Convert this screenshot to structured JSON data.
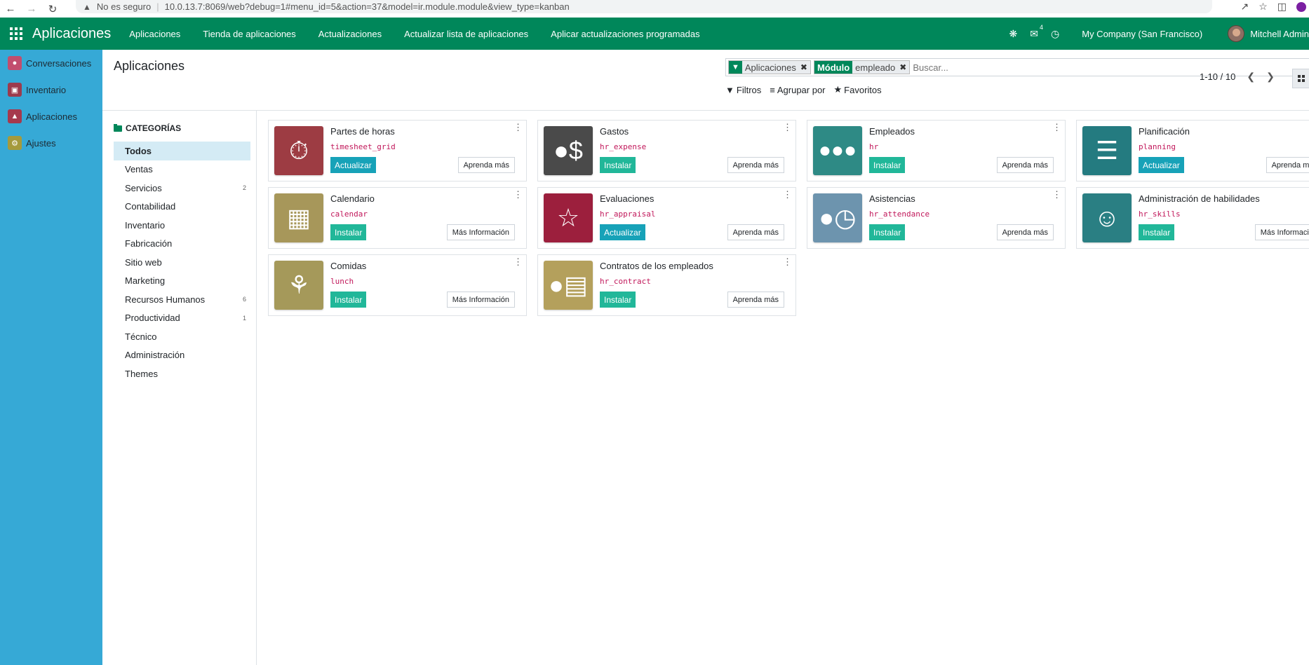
{
  "browser": {
    "insecure_label": "No es seguro",
    "url": "10.0.13.7:8069/web?debug=1#menu_id=5&action=37&model=ir.module.module&view_type=kanban"
  },
  "navbar": {
    "brand": "Aplicaciones",
    "menu": [
      "Aplicaciones",
      "Tienda de aplicaciones",
      "Actualizaciones",
      "Actualizar lista de aplicaciones",
      "Aplicar actualizaciones programadas"
    ],
    "messages_badge": "4",
    "company": "My Company (San Francisco)",
    "user": "Mitchell Admin",
    "accent_color": "#00875a"
  },
  "leftbar": {
    "items": [
      {
        "label": "Conversaciones",
        "icon": "chat-icon",
        "color": "#c24e6e"
      },
      {
        "label": "Inventario",
        "icon": "box-icon",
        "color": "#9c3b4d"
      },
      {
        "label": "Aplicaciones",
        "icon": "apps-icon",
        "color": "#a6394d"
      },
      {
        "label": "Ajustes",
        "icon": "gear-icon",
        "color": "#a59a3c"
      }
    ]
  },
  "control": {
    "title": "Aplicaciones",
    "facets": [
      {
        "label": "",
        "value": "Aplicaciones",
        "icon": "filter-icon"
      },
      {
        "label": "Módulo",
        "value": "empleado",
        "icon": ""
      }
    ],
    "search_placeholder": "Buscar...",
    "filters_label": "Filtros",
    "groupby_label": "Agrupar por",
    "favorites_label": "Favoritos",
    "pager": "1-10 / 10"
  },
  "categories": {
    "header": "CATEGORÍAS",
    "items": [
      {
        "label": "Todos",
        "count": ""
      },
      {
        "label": "Ventas",
        "count": ""
      },
      {
        "label": "Servicios",
        "count": "2"
      },
      {
        "label": "Contabilidad",
        "count": ""
      },
      {
        "label": "Inventario",
        "count": ""
      },
      {
        "label": "Fabricación",
        "count": ""
      },
      {
        "label": "Sitio web",
        "count": ""
      },
      {
        "label": "Marketing",
        "count": ""
      },
      {
        "label": "Recursos Humanos",
        "count": "6"
      },
      {
        "label": "Productividad",
        "count": "1"
      },
      {
        "label": "Técnico",
        "count": ""
      },
      {
        "label": "Administración",
        "count": ""
      },
      {
        "label": "Themes",
        "count": ""
      }
    ]
  },
  "cards": [
    {
      "title": "Partes de horas",
      "tech": "timesheet_grid",
      "action": "Actualizar",
      "more": "Aprenda más",
      "icon": "stopwatch-icon",
      "color": "#9d3c43"
    },
    {
      "title": "Gastos",
      "tech": "hr_expense",
      "action": "Instalar",
      "more": "Aprenda más",
      "icon": "expense-icon",
      "color": "#4a4a4a"
    },
    {
      "title": "Empleados",
      "tech": "hr",
      "action": "Instalar",
      "more": "Aprenda más",
      "icon": "people-icon",
      "color": "#2e8a85"
    },
    {
      "title": "Planificación",
      "tech": "planning",
      "action": "Actualizar",
      "more": "Aprenda más",
      "icon": "planning-icon",
      "color": "#247b80"
    },
    {
      "title": "Calendario",
      "tech": "calendar",
      "action": "Instalar",
      "more": "Más Información",
      "icon": "calendar-icon",
      "color": "#a7975a"
    },
    {
      "title": "Evaluaciones",
      "tech": "hr_appraisal",
      "action": "Actualizar",
      "more": "Aprenda más",
      "icon": "star-icon",
      "color": "#9c1f3d"
    },
    {
      "title": "Asistencias",
      "tech": "hr_attendance",
      "action": "Instalar",
      "more": "Aprenda más",
      "icon": "attendance-icon",
      "color": "#6d94ae"
    },
    {
      "title": "Administración de habilidades",
      "tech": "hr_skills",
      "action": "Instalar",
      "more": "Más Información",
      "icon": "skills-icon",
      "color": "#2a7f83"
    },
    {
      "title": "Comidas",
      "tech": "lunch",
      "action": "Instalar",
      "more": "Más Información",
      "icon": "fork-knife-icon",
      "color": "#a5995a"
    },
    {
      "title": "Contratos de los empleados",
      "tech": "hr_contract",
      "action": "Instalar",
      "more": "Aprenda más",
      "icon": "contract-icon",
      "color": "#b4a05c"
    }
  ]
}
